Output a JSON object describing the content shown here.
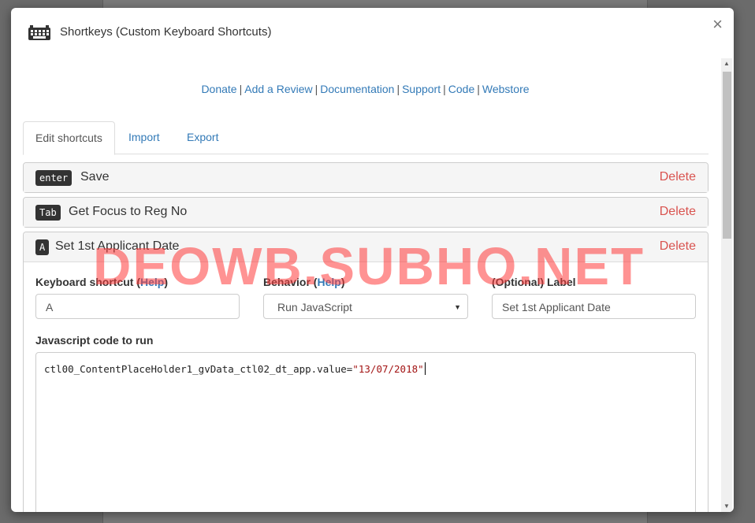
{
  "dialog": {
    "title": "Shortkeys (Custom Keyboard Shortcuts)",
    "icon": "keyboard-icon",
    "close_label": "×"
  },
  "links": [
    {
      "label": "Donate"
    },
    {
      "label": "Add a Review"
    },
    {
      "label": "Documentation"
    },
    {
      "label": "Support"
    },
    {
      "label": "Code"
    },
    {
      "label": "Webstore"
    }
  ],
  "link_separator": "|",
  "tabs": [
    {
      "label": "Edit shortcuts",
      "active": true
    },
    {
      "label": "Import",
      "active": false
    },
    {
      "label": "Export",
      "active": false
    }
  ],
  "shortcuts": [
    {
      "key": "enter",
      "title": "Save",
      "delete_label": "Delete"
    },
    {
      "key": "Tab",
      "title": "Get Focus to Reg No",
      "delete_label": "Delete"
    },
    {
      "key": "A",
      "title": "Set 1st Applicant Date",
      "delete_label": "Delete"
    }
  ],
  "edit_form": {
    "shortcut_label": "Keyboard shortcut (",
    "help_text": "Help",
    "paren_close": ")",
    "behavior_label": "Behavior (",
    "optional_label": "(Optional) Label",
    "shortcut_value": "A",
    "behavior_value": "Run JavaScript",
    "label_value": "Set 1st Applicant Date",
    "code_label": "Javascript code to run",
    "code_prefix": "ctl00_ContentPlaceHolder1_gvData_ctl02_dt_app.value=",
    "code_string": "\"13/07/2018\""
  },
  "watermark": "DEOWB.SUBHO.NET",
  "colors": {
    "link": "#337ab7",
    "delete": "#d9534f",
    "kbd_bg": "#333333",
    "watermark": "#ff3b3b"
  }
}
